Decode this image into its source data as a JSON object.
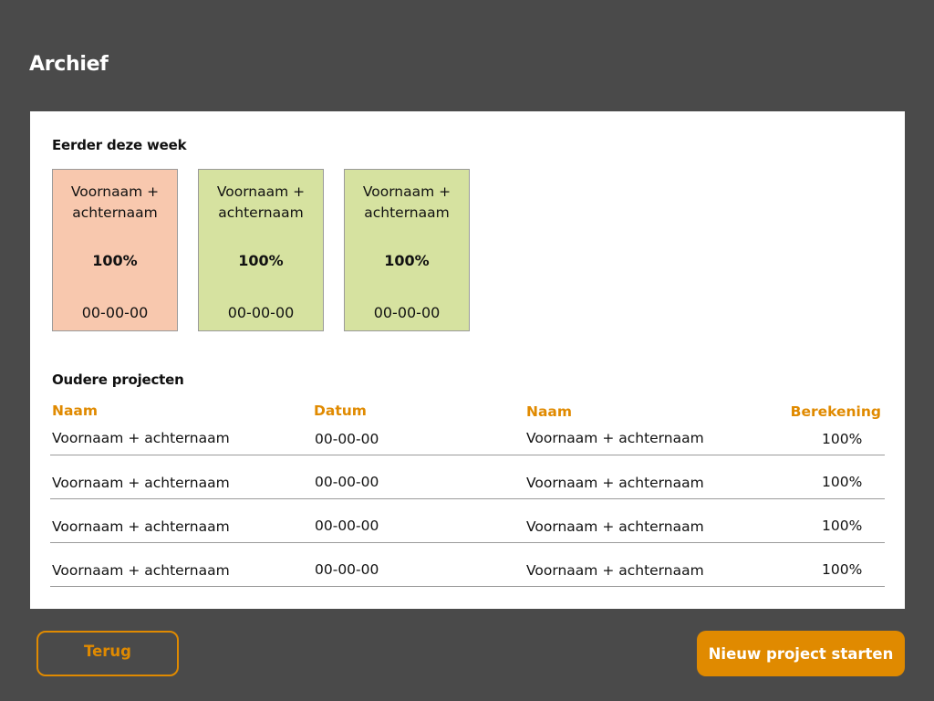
{
  "header": {
    "title": "Archief"
  },
  "recent": {
    "heading": "Eerder deze week",
    "cards": [
      {
        "name_line1": "Voornaam +",
        "name_line2": "achternaam",
        "percentage": "100%",
        "date": "00-00-00",
        "color": "#f8c8ae"
      },
      {
        "name_line1": "Voornaam +",
        "name_line2": "achternaam",
        "percentage": "100%",
        "date": "00-00-00",
        "color": "#d6e2a0"
      },
      {
        "name_line1": "Voornaam +",
        "name_line2": "achternaam",
        "percentage": "100%",
        "date": "00-00-00",
        "color": "#d6e2a0"
      }
    ]
  },
  "older": {
    "heading": "Oudere projecten",
    "columns": {
      "naam": "Naam",
      "datum": "Datum",
      "naam2": "Naam",
      "berekening": "Berekening"
    },
    "rows": [
      {
        "naam": "Voornaam + achternaam",
        "datum": "00-00-00",
        "naam2": "Voornaam + achternaam",
        "berekening": "100%"
      },
      {
        "naam": "Voornaam + achternaam",
        "datum": "00-00-00",
        "naam2": "Voornaam + achternaam",
        "berekening": "100%"
      },
      {
        "naam": "Voornaam + achternaam",
        "datum": "00-00-00",
        "naam2": "Voornaam + achternaam",
        "berekening": "100%"
      },
      {
        "naam": "Voornaam + achternaam",
        "datum": "00-00-00",
        "naam2": "Voornaam + achternaam",
        "berekening": "100%"
      }
    ]
  },
  "footer": {
    "back_label": "Terug",
    "new_project_label": "Nieuw project starten"
  },
  "colors": {
    "background": "#4a4a4a",
    "accent": "#e08a00",
    "panel": "#ffffff"
  }
}
